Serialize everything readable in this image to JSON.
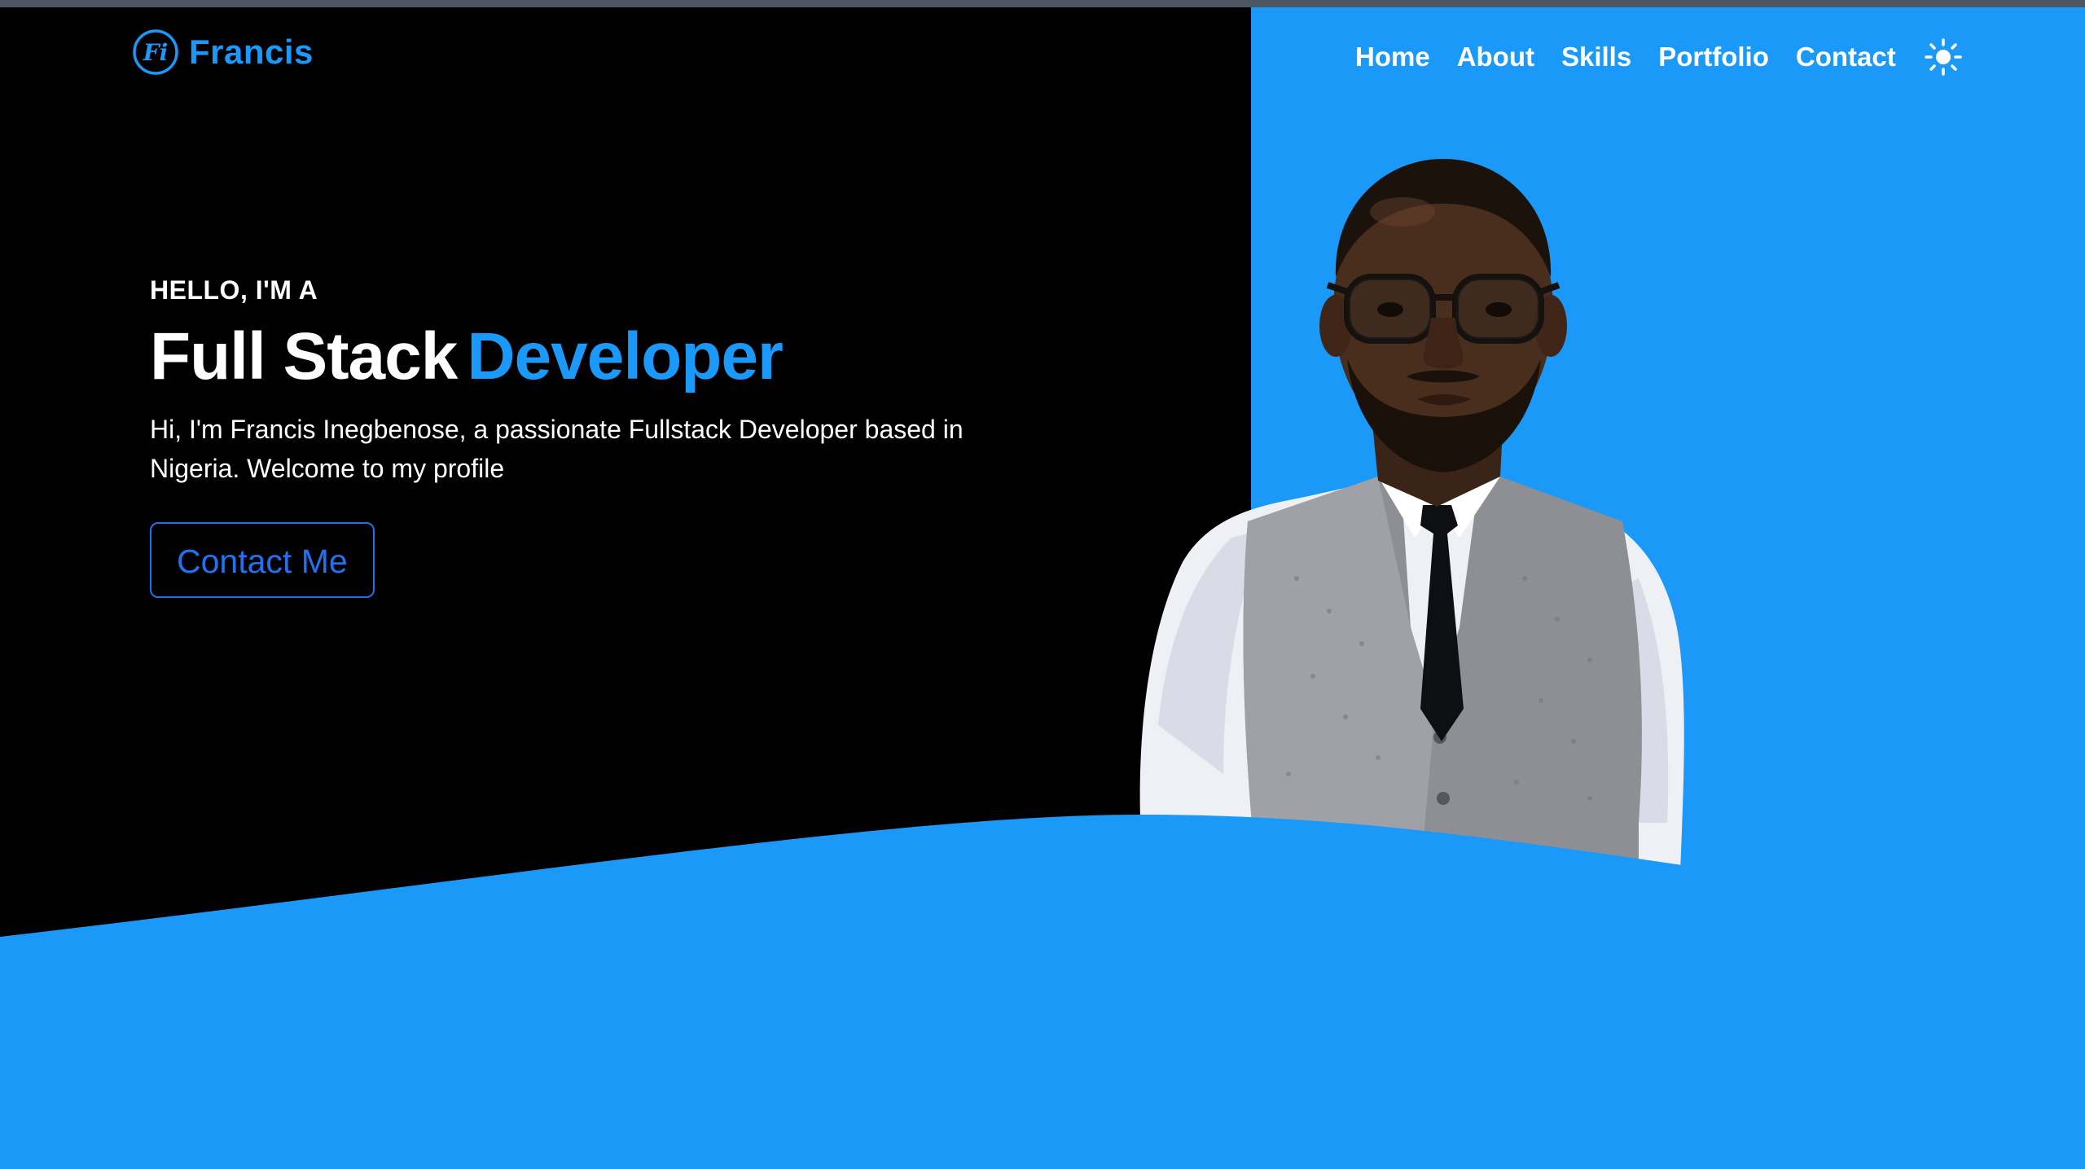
{
  "brand": {
    "name": "Francis",
    "monogram": "Fi",
    "accent_color": "#1a99f9"
  },
  "nav": {
    "items": [
      {
        "label": "Home"
      },
      {
        "label": "About"
      },
      {
        "label": "Skills"
      },
      {
        "label": "Portfolio"
      },
      {
        "label": "Contact"
      }
    ],
    "theme_toggle_icon": "sun-icon"
  },
  "hero": {
    "eyebrow": "HELLO, I'M A",
    "headline_plain": "Full Stack",
    "headline_accent": "Developer",
    "intro_line1": "Hi, I'm Francis Inegbenose, a passionate Fullstack Developer based in",
    "intro_line2": "Nigeria. Welcome to my profile",
    "cta_label": "Contact Me"
  },
  "colors": {
    "background_dark": "#000000",
    "background_blue": "#1a99f9",
    "cta_border": "#1f6ff0",
    "text_light": "#ffffff"
  }
}
